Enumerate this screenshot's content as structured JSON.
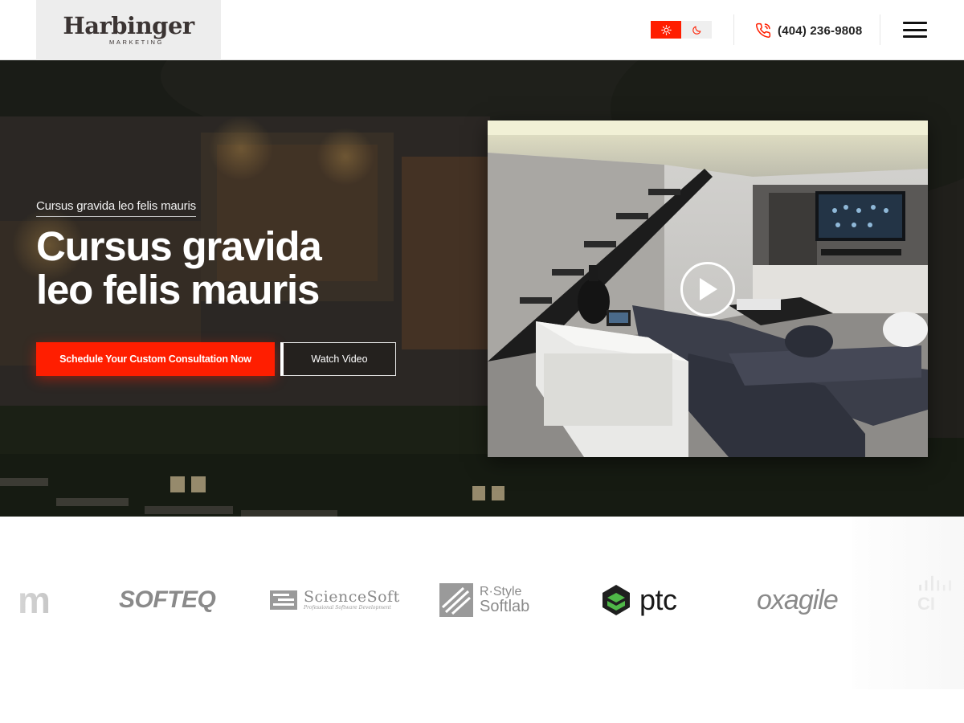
{
  "header": {
    "logo": {
      "name": "Harbinger",
      "sub": "MARKETING"
    },
    "theme": {
      "light_icon": "sun-icon",
      "dark_icon": "moon-icon",
      "active": "light",
      "accent": "#ff1e00"
    },
    "phone": {
      "icon": "phone-icon",
      "number": "(404) 236-9808"
    },
    "menu_icon": "hamburger-menu-icon"
  },
  "hero": {
    "eyebrow": "Cursus gravida leo felis mauris",
    "title": "Cursus gravida leo felis mauris",
    "cta_primary": "Schedule Your Custom Consultation Now",
    "cta_secondary": "Watch Video",
    "video": {
      "play_icon": "play-icon"
    }
  },
  "clients": {
    "logos": [
      {
        "name": "partial-m-logo",
        "text": "m"
      },
      {
        "name": "softeq",
        "text": "SOFTEQ"
      },
      {
        "name": "sciencesoft",
        "text": "ScienceSoft",
        "tagline": "Professional Software Development"
      },
      {
        "name": "rstyle-softlab",
        "top": "R·Style",
        "bottom": "Softlab"
      },
      {
        "name": "ptc",
        "text": "ptc"
      },
      {
        "name": "oxagile",
        "text": "oxagile"
      },
      {
        "name": "cisco-partial",
        "text": "CI"
      }
    ]
  },
  "colors": {
    "accent": "#ff1e00",
    "logo_gray": "#8a8a8a",
    "ptc_green": "#4fb848"
  }
}
